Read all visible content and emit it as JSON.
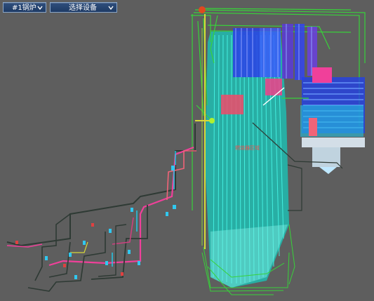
{
  "toolbar": {
    "boiler_select": {
      "value": "#1锅炉"
    },
    "device_select": {
      "value": "选择设备"
    }
  },
  "scene": {
    "furnace_label": "燃烧器区域",
    "colors": {
      "background": "#5e5e5e",
      "water_wall": "#2fe0d0",
      "superheater": "#2a3fe6",
      "pipe_green": "#38d23a",
      "pipe_magenta": "#f0409a",
      "pipe_dark": "#2e3a34",
      "pipe_cyan": "#20c8e8",
      "pipe_yellow": "#d8d83a",
      "hot_block": "#f04a6a",
      "toolbar": "#1e3a64"
    }
  }
}
